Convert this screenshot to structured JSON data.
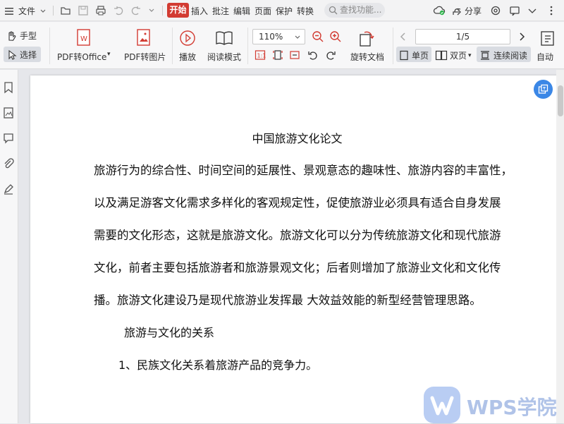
{
  "titlebar": {
    "file_menu": "文件",
    "tabs": [
      "插入",
      "批注",
      "编辑",
      "页面",
      "保护",
      "转换"
    ],
    "active_tab": "开始",
    "search_placeholder": "查找功能...",
    "share": "分享"
  },
  "ribbon": {
    "hand_tool": "手型",
    "select_tool": "选择",
    "pdf_to_office": "PDF转Office",
    "pdf_to_image": "PDF转图片",
    "play": "播放",
    "read_mode": "阅读模式",
    "zoom_value": "110%",
    "rotate_doc": "旋转文档",
    "page_indicator": "1/5",
    "single_page": "单页",
    "double_page": "双页",
    "continuous": "连续阅读",
    "auto_scroll": "自动"
  },
  "document": {
    "title": "中国旅游文化论文",
    "paragraph_lines": [
      "旅游行为的综合性、时间空间的延展性、景观意态的趣味性、旅游内容的丰富性，",
      "以及满足游客文化需求多样化的客观规定性，促使旅游业必须具有适合自身发展",
      "需要的文化形态，这就是旅游文化。旅游文化可以分为传统旅游文化和现代旅游",
      "文化，前者主要包括旅游者和旅游景观文化；后者则增加了旅游业文化和文化传",
      "播。旅游文化建设乃是现代旅游业发挥最  大效益效能的新型经营管理思路。"
    ],
    "heading": "旅游与文化的关系",
    "item1": "1、民族文化关系着旅游产品的竞争力。"
  },
  "watermark": {
    "text": "WPS学院"
  },
  "colors": {
    "accent_red": "#d23b32",
    "page_bg": "#ffffff",
    "float_button": "#3b87e6"
  }
}
